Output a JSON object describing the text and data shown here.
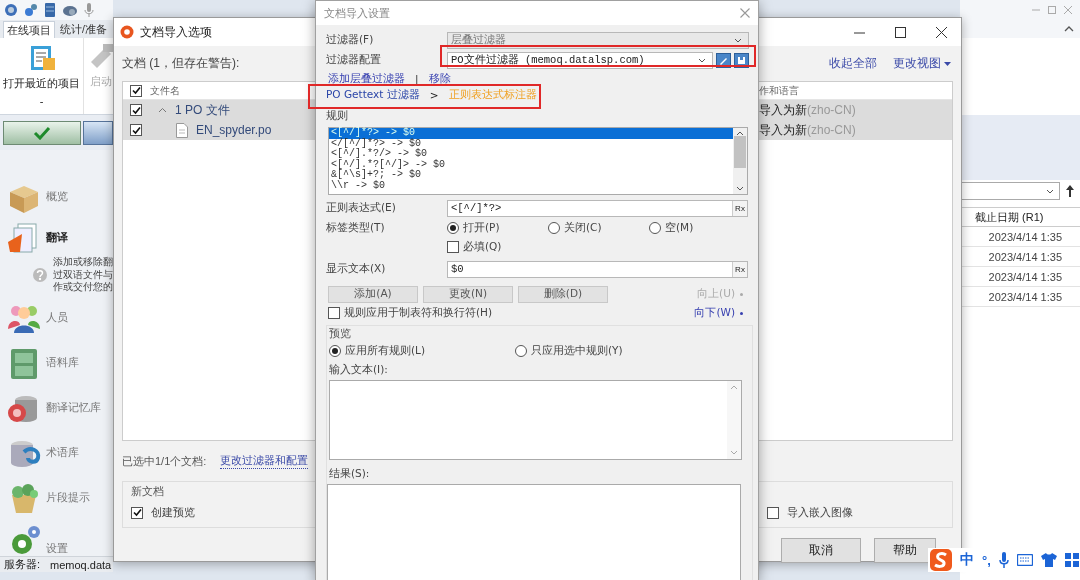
{
  "main_window": {
    "tabs": [
      {
        "label": "在线项目",
        "selected": true
      },
      {
        "label": "统计/准备",
        "selected": false
      }
    ],
    "ribbon_buttons": [
      {
        "label": "打开最近的项目",
        "subtitle": "-",
        "disabled": false
      },
      {
        "label": "启动",
        "disabled": true
      }
    ],
    "sidebar": [
      {
        "label": "概览",
        "selected": false
      },
      {
        "label": "翻译",
        "selected": true,
        "description": [
          "添加或移除翻",
          "过双语文件与",
          "作或交付您的"
        ]
      },
      {
        "label": "人员",
        "selected": false
      },
      {
        "label": "语料库",
        "selected": false
      },
      {
        "label": "翻译记忆库",
        "selected": false
      },
      {
        "label": "术语库",
        "selected": false
      },
      {
        "label": "片段提示",
        "selected": false
      },
      {
        "label": "设置",
        "selected": false
      }
    ],
    "status_bar": {
      "label": "服务器:",
      "value": "memoq.data"
    },
    "projects_table": {
      "column": "截止日期 (R1)",
      "rows": [
        "2023/4/14 1:35",
        "2023/4/14 1:35",
        "2023/4/14 1:35",
        "2023/4/14 1:35"
      ]
    }
  },
  "options_window": {
    "title": "文档导入选项",
    "documents_label": "文档 (1，但存在警告):",
    "links": [
      "收起全部",
      "更改视图"
    ],
    "table": {
      "header_checked": true,
      "columns": [
        "文件名",
        "作和语言"
      ],
      "rows": [
        {
          "name": "1 PO 文件",
          "checked": true,
          "selected": true,
          "expanded": true,
          "action": "导入为新",
          "language": "(zho-CN)",
          "children": [
            {
              "name": "EN_spyder.po",
              "checked": true,
              "selected": true,
              "action": "导入为新",
              "language": "(zho-CN)"
            }
          ]
        }
      ]
    },
    "selection_label": "已选中1/1个文档:",
    "change_link": "更改过滤器和配置",
    "new_documents": {
      "title": "新文档",
      "options": [
        {
          "label": "创建预览",
          "checked": true
        },
        {
          "label": "导入嵌入图像",
          "checked": false
        }
      ]
    },
    "buttons": [
      "取消",
      "帮助"
    ]
  },
  "settings_dialog": {
    "title": "文档导入设置",
    "filter": {
      "label": "过滤器(F)",
      "value": "层叠过滤器",
      "disabled": true
    },
    "filter_config": {
      "label": "过滤器配置",
      "value": "PO文件过滤器 (memoq.datalsp.com)"
    },
    "links": [
      "添加层叠过滤器",
      "|",
      "移除"
    ],
    "breadcrumb": [
      {
        "label": "PO Gettext 过滤器",
        "selected": false
      },
      {
        "label": "正则表达式标注器",
        "selected": true
      }
    ],
    "breadcrumb_separator": ">",
    "rules_label": "规则",
    "rules": [
      {
        "text": "<[^/]*?> -> $0",
        "selected": true
      },
      {
        "text": "</[^/]*?> -> $0",
        "selected": false
      },
      {
        "text": "<[^/].*?/> -> $0",
        "selected": false
      },
      {
        "text": "<[^/].*?[^/]> -> $0",
        "selected": false
      },
      {
        "text": "&[^\\s]+?; -> $0",
        "selected": false
      },
      {
        "text": "\\\\r -> $0",
        "selected": false
      }
    ],
    "regex": {
      "label": "正则表达式(E)",
      "value": "<[^/]*?>",
      "button": "Rx"
    },
    "tag_type": {
      "label": "标签类型(T)",
      "options": [
        {
          "label": "打开(P)",
          "selected": true
        },
        {
          "label": "关闭(C)",
          "selected": false
        },
        {
          "label": "空(M)",
          "selected": false
        }
      ]
    },
    "required": {
      "label": "必填(Q)",
      "checked": false
    },
    "display_text": {
      "label": "显示文本(X)",
      "value": "$0",
      "button": "Rx"
    },
    "buttons": [
      "添加(A)",
      "更改(N)",
      "删除(D)"
    ],
    "move": [
      {
        "label": "向上(U)",
        "disabled": true
      },
      {
        "label": "向下(W)",
        "disabled": false
      }
    ],
    "apply_tabs": {
      "label": "规则应用于制表符和换行符(H)",
      "checked": false
    },
    "preview": {
      "title": "预览",
      "options": [
        {
          "label": "应用所有规则(L)",
          "selected": true
        },
        {
          "label": "只应用选中规则(Y)",
          "selected": false
        }
      ],
      "input_label": "输入文本(I):",
      "result_label": "结果(S):"
    }
  },
  "ime_toolbar": {
    "mode": "中",
    "punctuation": "°,"
  }
}
